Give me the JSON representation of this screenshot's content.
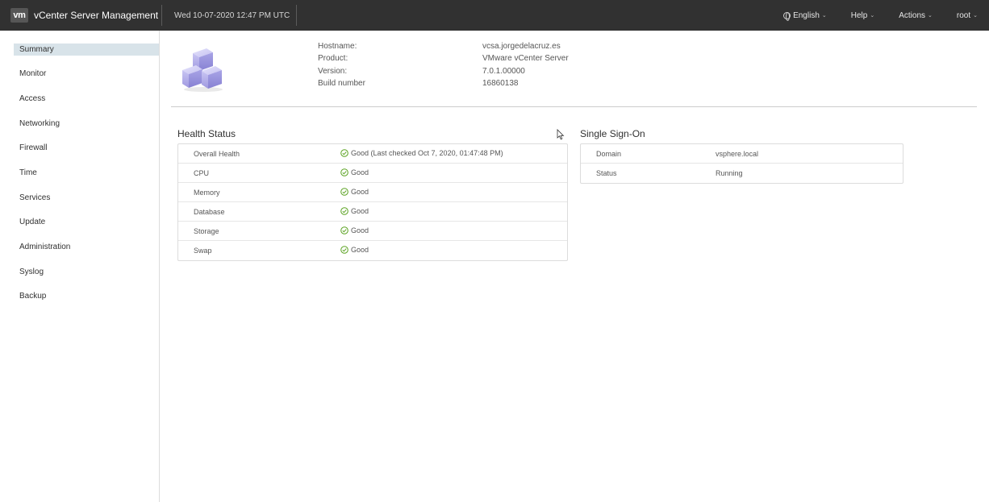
{
  "header": {
    "logo": "vm",
    "app_title": "vCenter Server Management",
    "datetime": "Wed 10-07-2020 12:47 PM UTC",
    "menus": {
      "language": "English",
      "help": "Help",
      "actions": "Actions",
      "user": "root"
    }
  },
  "sidebar": {
    "items": [
      "Summary",
      "Monitor",
      "Access",
      "Networking",
      "Firewall",
      "Time",
      "Services",
      "Update",
      "Administration",
      "Syslog",
      "Backup"
    ],
    "active": "Summary"
  },
  "summary": {
    "labels": {
      "hostname": "Hostname:",
      "product": "Product:",
      "version": "Version:",
      "build": "Build number"
    },
    "values": {
      "hostname": "vcsa.jorgedelacruz.es",
      "product": "VMware vCenter Server",
      "version": "7.0.1.00000",
      "build": "16860138"
    },
    "icon": "cubes-icon"
  },
  "health_status": {
    "title": "Health Status",
    "rows": [
      {
        "key": "Overall Health",
        "value": "Good (Last checked Oct 7, 2020, 01:47:48 PM)"
      },
      {
        "key": "CPU",
        "value": "Good"
      },
      {
        "key": "Memory",
        "value": "Good"
      },
      {
        "key": "Database",
        "value": "Good"
      },
      {
        "key": "Storage",
        "value": "Good"
      },
      {
        "key": "Swap",
        "value": "Good"
      }
    ],
    "status_color": "#5aa220"
  },
  "sso": {
    "title": "Single Sign-On",
    "rows": [
      {
        "key": "Domain",
        "value": "vsphere.local"
      },
      {
        "key": "Status",
        "value": "Running"
      }
    ]
  }
}
